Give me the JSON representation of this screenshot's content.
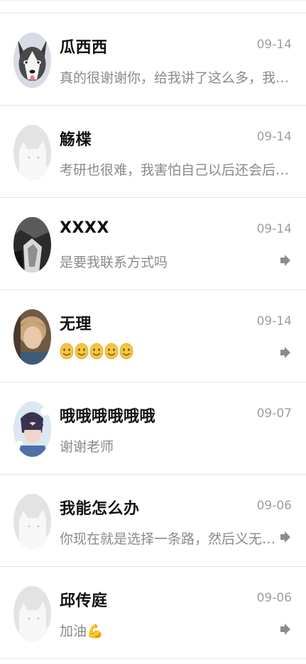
{
  "chats": [
    {
      "name": "瓜西西",
      "time": "09-14",
      "preview": "真的很谢谢你，给我讲了这么多，我会好好想...",
      "avatar": "husky-dog-avatar",
      "forwarded": false
    },
    {
      "name": "觞楪",
      "time": "09-14",
      "preview": "考研也很难，我害怕自己以后还会后悔高中没...",
      "avatar": "default-cat-avatar",
      "forwarded": false
    },
    {
      "name": "XXXX",
      "time": "09-14",
      "preview": "是要我联系方式吗",
      "avatar": "dark-photo-avatar",
      "forwarded": true
    },
    {
      "name": "无理",
      "time": "09-14",
      "preview": "",
      "emoji": [
        "smile-emoji",
        "smile-emoji",
        "smile-emoji",
        "smile-emoji",
        "smile-emoji"
      ],
      "avatar": "portrait-photo-avatar",
      "forwarded": true
    },
    {
      "name": "哦哦哦哦哦哦",
      "time": "09-07",
      "preview": "谢谢老师",
      "avatar": "anime-photo-avatar",
      "forwarded": false
    },
    {
      "name": "我能怎么办",
      "time": "09-06",
      "preview": "你现在就是选择一条路，然后义无反顾，不...",
      "avatar": "default-cat-avatar",
      "forwarded": true
    },
    {
      "name": "邱传庭",
      "time": "09-06",
      "preview": "加油💪",
      "avatar": "default-cat-avatar",
      "forwarded": true
    }
  ],
  "colors": {
    "name": "#111111",
    "time": "#9e9e9e",
    "preview": "#8a8a8a",
    "divider": "#e6e6e6",
    "default_avatar_bg": "#e3e3e3",
    "emoji_face": "#f5c542",
    "forward_icon": "#8c8c8c"
  }
}
